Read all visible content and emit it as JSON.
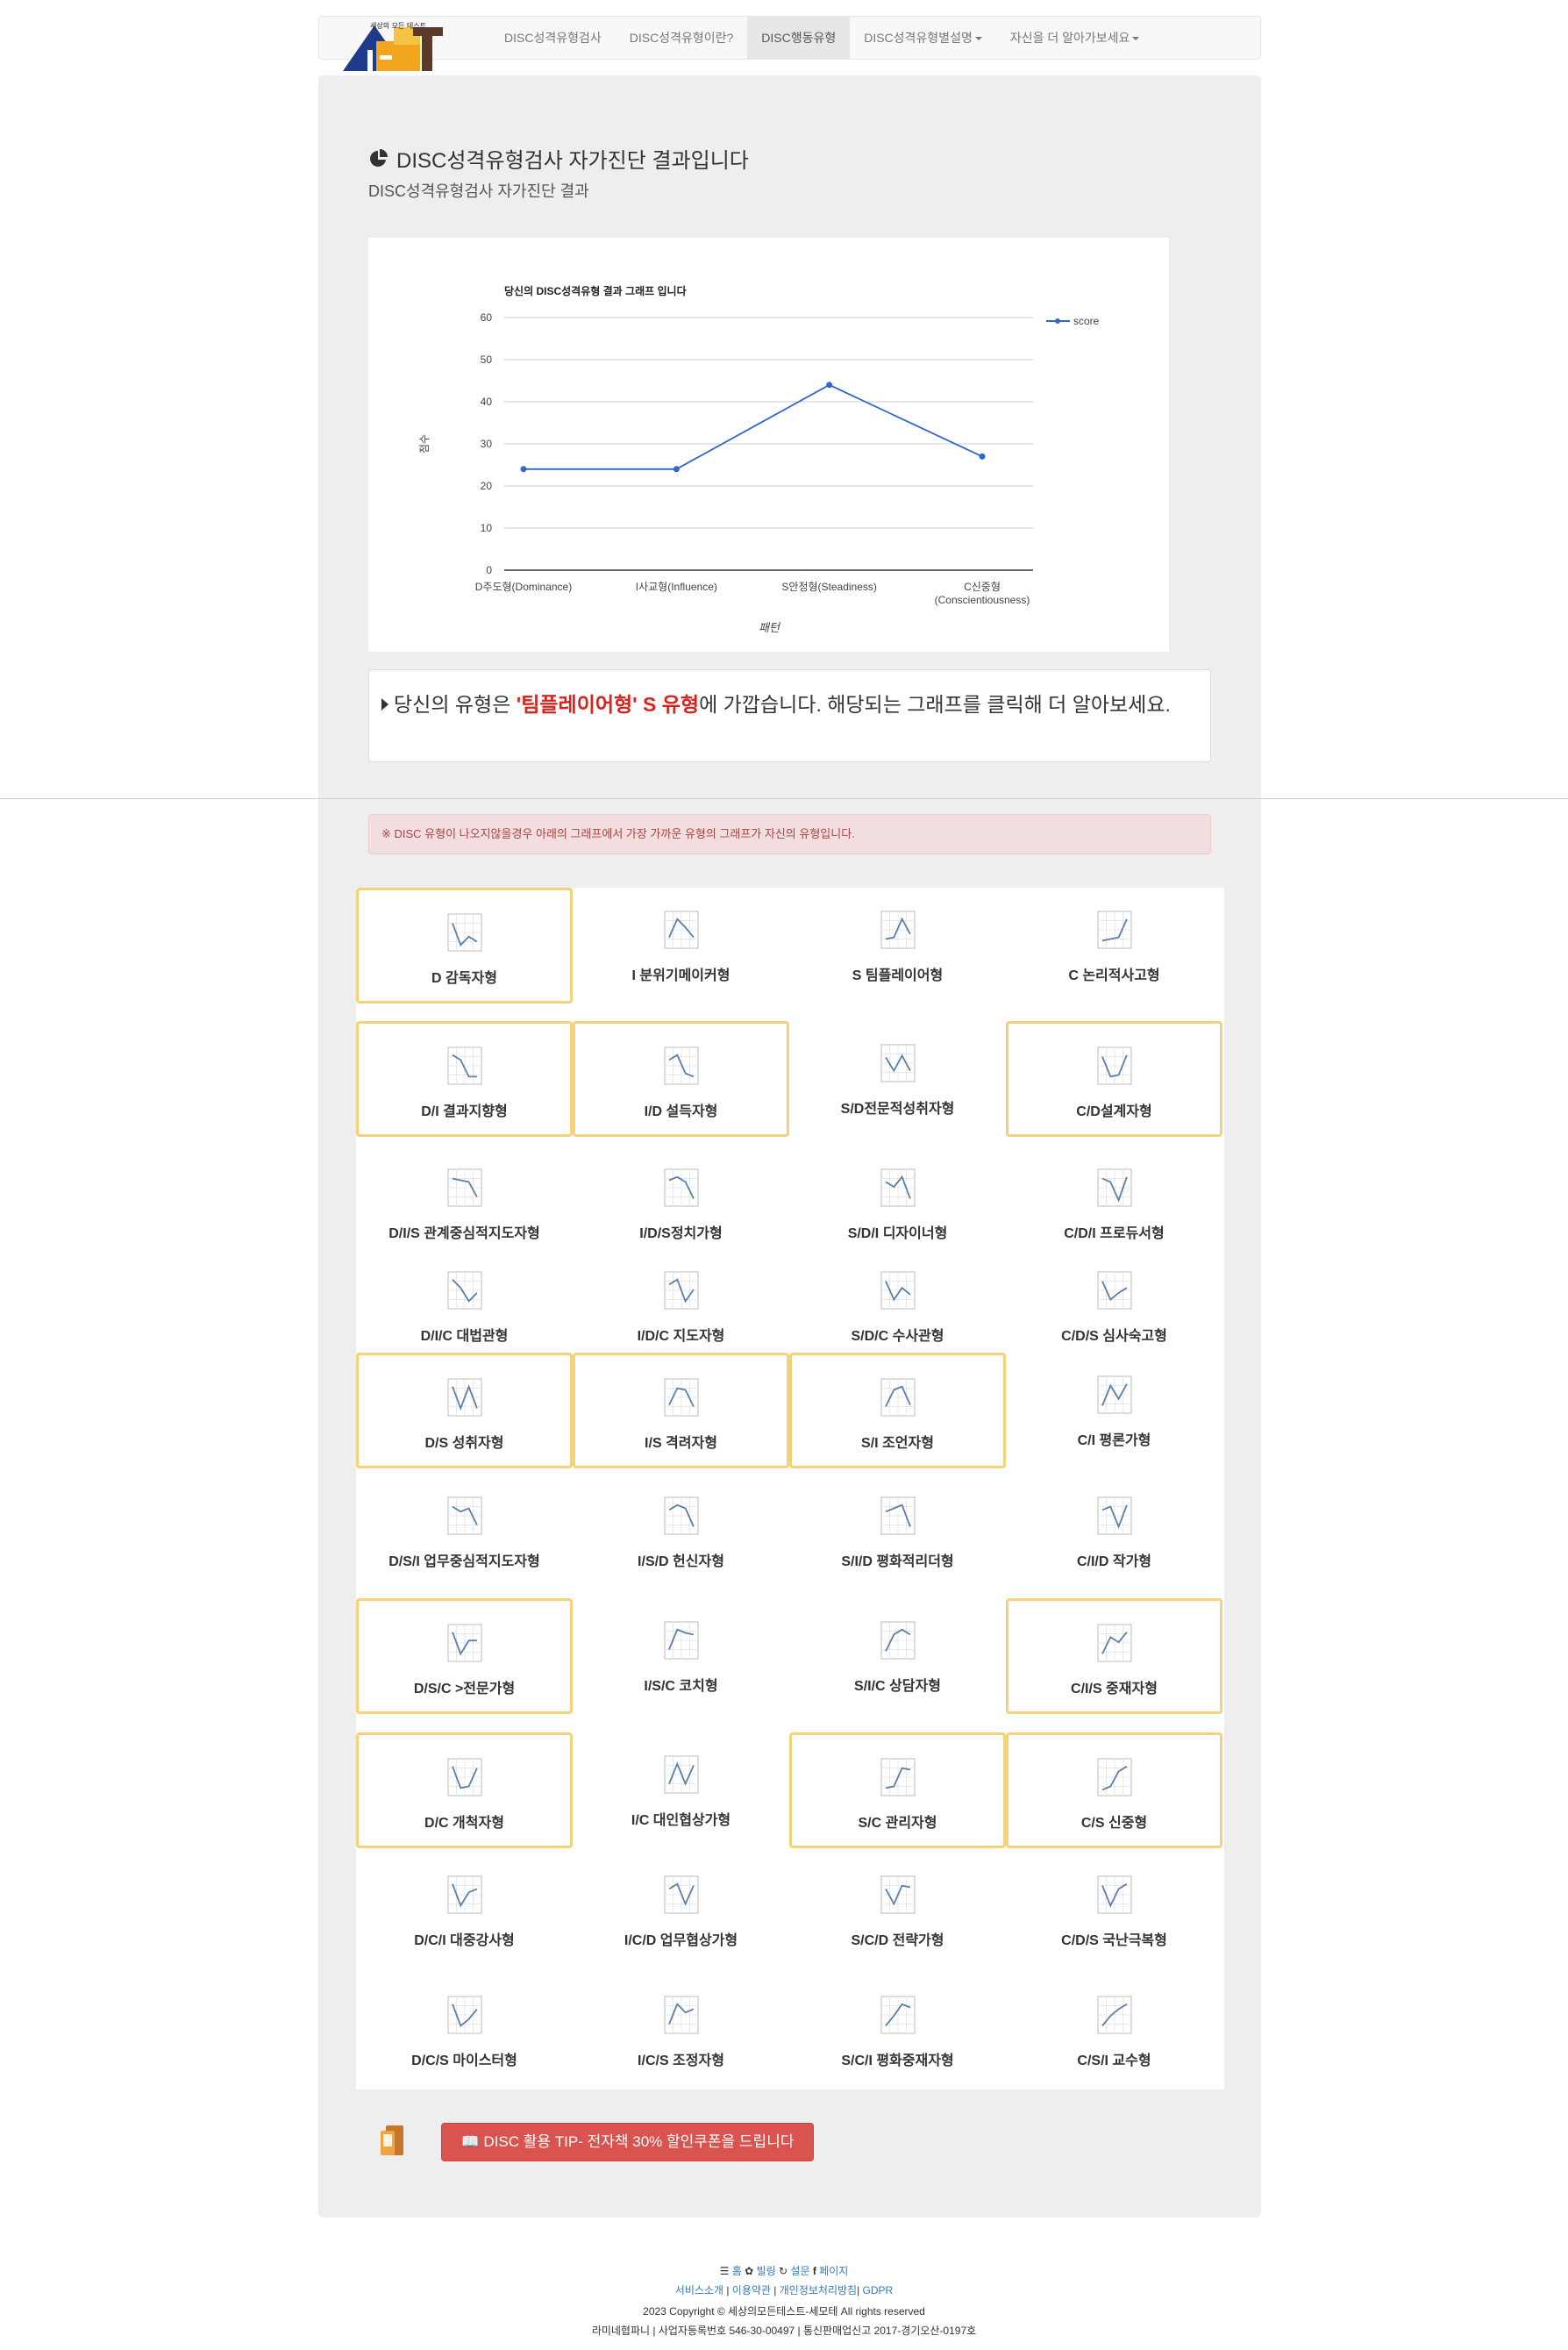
{
  "nav": {
    "logo_text": "세상의 모든 테스트",
    "items": [
      {
        "label": "DISC성격유형검사",
        "active": false,
        "dropdown": false
      },
      {
        "label": "DISC성격유형이란?",
        "active": false,
        "dropdown": false
      },
      {
        "label": "DISC행동유형",
        "active": true,
        "dropdown": false
      },
      {
        "label": "DISC성격유형별설명",
        "active": false,
        "dropdown": true
      },
      {
        "label": "자신을 더 알아가보세요",
        "active": false,
        "dropdown": true
      }
    ]
  },
  "header": {
    "title": "DISC성격유형검사 자가진단 결과입니다",
    "subtitle": "DISC성격유형검사 자가진단 결과"
  },
  "chart_data": {
    "type": "line",
    "title": "당신의 DISC성격유형 결과 그래프 입니다",
    "xlabel": "패턴",
    "ylabel": "점수",
    "categories": [
      "D주도형(Dominance)",
      "I사교형(Influence)",
      "S안정형(Steadiness)",
      "C신중형 (Conscientiousness)"
    ],
    "series": [
      {
        "name": "score",
        "values": [
          24,
          24,
          44,
          27
        ]
      }
    ],
    "ylim": [
      0,
      60
    ],
    "yticks": [
      0,
      10,
      20,
      30,
      40,
      50,
      60
    ],
    "grid": true,
    "legend": "top-right",
    "color": "#3366cc"
  },
  "result": {
    "prefix": "당신의 유형은 ",
    "type_name": "'팀플레이어형' S 유형",
    "suffix": "에 가깝습니다. 해당되는 그래프를 클릭해 더 알아보세요."
  },
  "alert": "※ DISC 유형이 나오지않을경우 아래의 그래프에서 가장 가까운 유형의 그래프가 자신의 유형입니다.",
  "types": [
    {
      "label": "D 감독자형",
      "highlight": true,
      "shape": [
        20,
        85,
        60,
        75
      ]
    },
    {
      "label": "I 분위기메이커형",
      "highlight": false,
      "shape": [
        70,
        15,
        40,
        70
      ]
    },
    {
      "label": "S 팀플레이어형",
      "highlight": false,
      "shape": [
        75,
        70,
        15,
        60
      ]
    },
    {
      "label": "C 논리적사고형",
      "highlight": false,
      "shape": [
        80,
        75,
        70,
        15
      ]
    },
    {
      "label": "D/I 결과지향형",
      "highlight": true,
      "shape": [
        15,
        30,
        80,
        80
      ]
    },
    {
      "label": "I/D 설득자형",
      "highlight": true,
      "shape": [
        30,
        15,
        70,
        80
      ]
    },
    {
      "label": "S/D전문적성취자형",
      "highlight": false,
      "shape": [
        30,
        70,
        25,
        70
      ]
    },
    {
      "label": "C/D설계자형",
      "highlight": true,
      "shape": [
        20,
        80,
        75,
        15
      ]
    },
    {
      "label": "D/I/S 관계중심적지도자형",
      "highlight": false,
      "shape": [
        20,
        25,
        30,
        75
      ]
    },
    {
      "label": "I/D/S정치가형",
      "highlight": false,
      "shape": [
        25,
        15,
        30,
        80
      ]
    },
    {
      "label": "S/D/I 디자이너형",
      "highlight": false,
      "shape": [
        30,
        45,
        15,
        80
      ]
    },
    {
      "label": "C/D/I 프로듀서형",
      "highlight": false,
      "shape": [
        20,
        30,
        85,
        15
      ]
    },
    {
      "label": "D/I/C 대법관형",
      "highlight": false,
      "shape": [
        15,
        40,
        80,
        55
      ]
    },
    {
      "label": "I/D/C 지도자형",
      "highlight": false,
      "shape": [
        30,
        15,
        80,
        45
      ]
    },
    {
      "label": "S/D/C 수사관형",
      "highlight": false,
      "shape": [
        20,
        75,
        40,
        60
      ]
    },
    {
      "label": "C/D/S 심사숙고형",
      "highlight": false,
      "shape": [
        20,
        75,
        55,
        40
      ]
    },
    {
      "label": "D/S 성취자형",
      "highlight": true,
      "shape": [
        15,
        80,
        15,
        80
      ]
    },
    {
      "label": "I/S 격려자형",
      "highlight": true,
      "shape": [
        70,
        20,
        25,
        75
      ]
    },
    {
      "label": "S/I 조언자형",
      "highlight": true,
      "shape": [
        75,
        25,
        15,
        70
      ]
    },
    {
      "label": "C/I 평론가형",
      "highlight": false,
      "shape": [
        80,
        20,
        60,
        15
      ]
    },
    {
      "label": "D/S/I 업무중심적지도자형",
      "highlight": false,
      "shape": [
        20,
        35,
        25,
        75
      ]
    },
    {
      "label": "I/S/D 헌신자형",
      "highlight": false,
      "shape": [
        30,
        15,
        25,
        80
      ]
    },
    {
      "label": "S/I/D 평화적리더형",
      "highlight": false,
      "shape": [
        35,
        25,
        15,
        80
      ]
    },
    {
      "label": "C/I/D 작가형",
      "highlight": false,
      "shape": [
        30,
        20,
        80,
        15
      ]
    },
    {
      "label": "D/S/C >전문가형",
      "highlight": true,
      "shape": [
        15,
        80,
        40,
        40
      ]
    },
    {
      "label": "I/S/C 코치형",
      "highlight": false,
      "shape": [
        75,
        15,
        25,
        30
      ]
    },
    {
      "label": "S/I/C 상담자형",
      "highlight": false,
      "shape": [
        80,
        30,
        15,
        30
      ]
    },
    {
      "label": "C/I/S 중재자형",
      "highlight": true,
      "shape": [
        80,
        30,
        45,
        15
      ]
    },
    {
      "label": "D/C 개척자형",
      "highlight": true,
      "shape": [
        15,
        80,
        75,
        20
      ]
    },
    {
      "label": "I/C 대인협상가형",
      "highlight": false,
      "shape": [
        75,
        15,
        75,
        20
      ]
    },
    {
      "label": "S/C 관리자형",
      "highlight": true,
      "shape": [
        80,
        75,
        20,
        25
      ]
    },
    {
      "label": "C/S 신중형",
      "highlight": true,
      "shape": [
        85,
        75,
        30,
        15
      ]
    },
    {
      "label": "D/C/I 대중강사형",
      "highlight": false,
      "shape": [
        15,
        80,
        40,
        30
      ]
    },
    {
      "label": "I/C/D 업무협상가형",
      "highlight": false,
      "shape": [
        30,
        15,
        75,
        20
      ]
    },
    {
      "label": "S/C/D 전략가형",
      "highlight": false,
      "shape": [
        30,
        75,
        20,
        25
      ]
    },
    {
      "label": "C/D/S 국난극복형",
      "highlight": false,
      "shape": [
        20,
        80,
        30,
        15
      ]
    },
    {
      "label": "D/C/S 마이스터형",
      "highlight": false,
      "shape": [
        15,
        80,
        60,
        30
      ]
    },
    {
      "label": "I/C/S 조정자형",
      "highlight": false,
      "shape": [
        75,
        15,
        40,
        30
      ]
    },
    {
      "label": "S/C/I 평화중재자형",
      "highlight": false,
      "shape": [
        80,
        50,
        15,
        25
      ]
    },
    {
      "label": "C/S/I 교수형",
      "highlight": false,
      "shape": [
        80,
        50,
        30,
        15
      ]
    }
  ],
  "tip": {
    "label": "DISC 활용 TIP- 전자책 30% 할인쿠폰을 드립니다"
  },
  "footer": {
    "line1": [
      "홈",
      "빌링",
      "설문",
      "페이지"
    ],
    "line2": [
      "서비스소개",
      "이용약관",
      "개인정보처리방침",
      "GDPR"
    ],
    "copyright": "2023 Copyright © 세상의모든테스트-세모테 All rights reserved",
    "company": "라미네협파니 | 사업자등록번호 546-30-00497 | 통신판매업신고 2017-경기오산-0197호"
  },
  "colors": {
    "accent": "#d9231d",
    "line": "#3366cc",
    "highlight_border": "#f4d27a",
    "tip_button": "#d9534f"
  }
}
